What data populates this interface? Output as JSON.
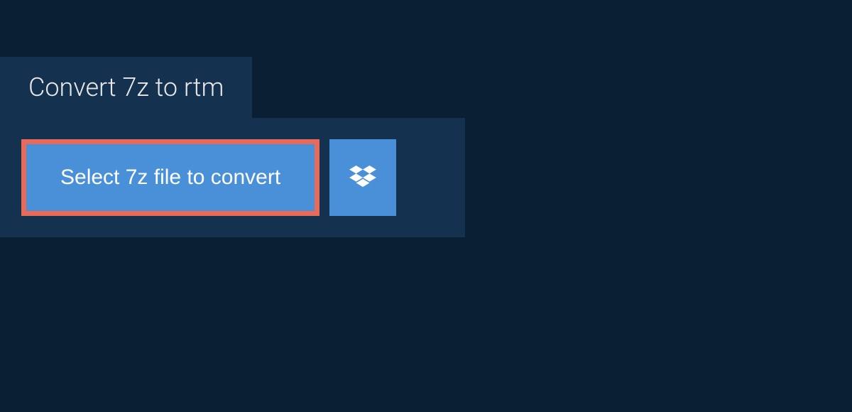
{
  "tab": {
    "title": "Convert 7z to rtm"
  },
  "actions": {
    "select_label": "Select 7z file to convert"
  },
  "colors": {
    "background": "#0a1f33",
    "panel": "#14314f",
    "primary": "#4a90d9",
    "highlight_border": "#e86a5a"
  }
}
